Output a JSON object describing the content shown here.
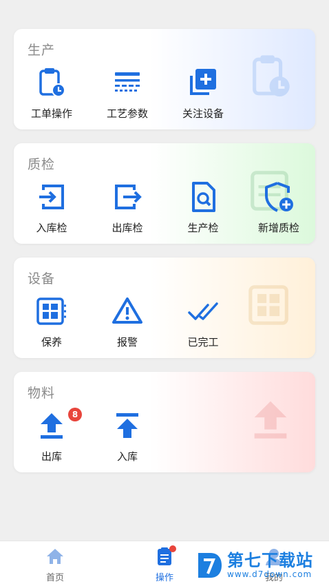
{
  "colors": {
    "accent": "#1f6fe0",
    "badge": "#e8453c"
  },
  "sections": [
    {
      "title": "生产",
      "items": [
        {
          "label": "工单操作",
          "icon": "clipboard-clock-icon"
        },
        {
          "label": "工艺参数",
          "icon": "process-lines-icon"
        },
        {
          "label": "关注设备",
          "icon": "add-square-stack-icon"
        }
      ]
    },
    {
      "title": "质检",
      "items": [
        {
          "label": "入库检",
          "icon": "enter-box-icon"
        },
        {
          "label": "出库检",
          "icon": "exit-box-icon"
        },
        {
          "label": "生产检",
          "icon": "document-search-icon"
        },
        {
          "label": "新增质检",
          "icon": "shield-add-icon"
        }
      ]
    },
    {
      "title": "设备",
      "items": [
        {
          "label": "保养",
          "icon": "device-panel-icon"
        },
        {
          "label": "报警",
          "icon": "warning-triangle-icon"
        },
        {
          "label": "已完工",
          "icon": "double-check-icon"
        }
      ]
    },
    {
      "title": "物料",
      "items": [
        {
          "label": "出库",
          "icon": "upload-arrow-icon",
          "badge": "8"
        },
        {
          "label": "入库",
          "icon": "upload-bar-arrow-icon"
        }
      ]
    }
  ],
  "tabbar": {
    "home": "首页",
    "ops": "操作",
    "mine": "我的"
  },
  "brand": {
    "name": "第七下载站",
    "url": "www.d7down.com"
  }
}
